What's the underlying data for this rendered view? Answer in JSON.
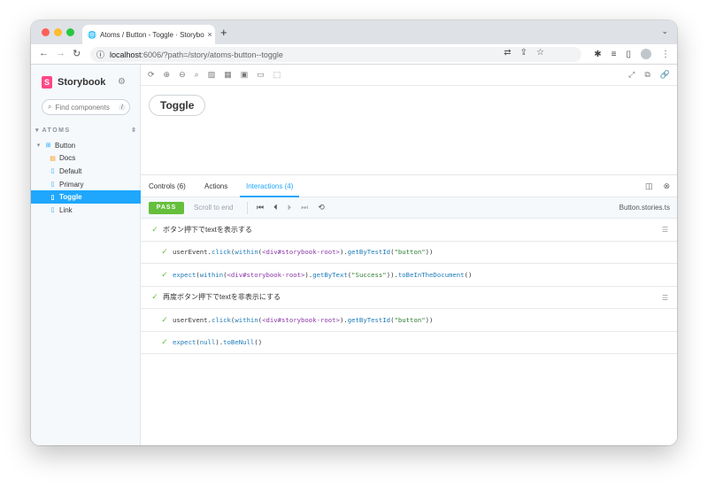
{
  "browser": {
    "tab_title": "Atoms / Button - Toggle · Storybook",
    "new_tab": "+",
    "tab_close": "×",
    "url_host": "localhost",
    "url_path": ":6006/?path=/story/atoms-button--toggle",
    "traffic_colors": [
      "#ff5f57",
      "#febc2e",
      "#28c840"
    ]
  },
  "sidebar": {
    "brand": "Storybook",
    "search_placeholder": "Find components",
    "search_shortcut": "/",
    "group_label": "ATOMS",
    "items": [
      {
        "label": "Button",
        "kind": "component",
        "icon": "component-icon",
        "selected": false
      },
      {
        "label": "Docs",
        "kind": "docs",
        "icon": "document-icon",
        "selected": false
      },
      {
        "label": "Default",
        "kind": "story",
        "icon": "bookmark-icon",
        "selected": false
      },
      {
        "label": "Primary",
        "kind": "story",
        "icon": "bookmark-icon",
        "selected": false
      },
      {
        "label": "Toggle",
        "kind": "story",
        "icon": "bookmark-icon",
        "selected": true
      },
      {
        "label": "Link",
        "kind": "story",
        "icon": "bookmark-icon",
        "selected": false
      }
    ]
  },
  "preview": {
    "button_label": "Toggle"
  },
  "addons": {
    "tabs": {
      "controls": "Controls (6)",
      "actions": "Actions",
      "interactions": "Interactions (4)"
    },
    "status": "PASS",
    "scroll_to_end": "Scroll to end",
    "file_name": "Button.stories.ts",
    "accent_color": "#1ea7fd",
    "pass_color": "#66bf3c"
  },
  "interactions": {
    "group1_title": "ボタン押下でtextを表示する",
    "group2_title": "再度ボタン押下でtextを非表示にする",
    "step1": {
      "a": "userEvent.",
      "b": "click",
      "c": "(",
      "d": "within",
      "e": "(",
      "f": "<div#storybook-root>",
      "g": ").",
      "h": "getByTestId",
      "i": "(",
      "j": "\"button\"",
      "k": "))"
    },
    "step2": {
      "a": "expect",
      "b": "(",
      "c": "within",
      "d": "(",
      "e": "<div#storybook-root>",
      "f": ").",
      "g": "getByText",
      "h": "(",
      "i": "\"Success\"",
      "j": ")).",
      "k": "toBeInTheDocument",
      "l": "()"
    },
    "step3": {
      "a": "userEvent.",
      "b": "click",
      "c": "(",
      "d": "within",
      "e": "(",
      "f": "<div#storybook-root>",
      "g": ").",
      "h": "getByTestId",
      "i": "(",
      "j": "\"button\"",
      "k": "))"
    },
    "step4": {
      "a": "expect",
      "b": "(",
      "c": "null",
      "d": ").",
      "e": "toBeNull",
      "f": "()"
    }
  }
}
